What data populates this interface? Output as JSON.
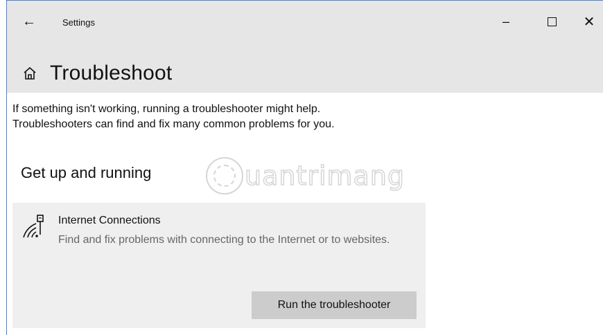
{
  "window": {
    "app_title": "Settings",
    "back_icon": "arrow-left-icon",
    "controls": {
      "minimize": "–",
      "maximize_icon": "square-icon",
      "close": "✕"
    }
  },
  "page": {
    "icon": "home-icon",
    "title": "Troubleshoot",
    "description": [
      "If something isn't working, running a troubleshooter might help.",
      "Troubleshooters can find and fix many common problems for you."
    ]
  },
  "section": {
    "title": "Get up and running"
  },
  "watermark": {
    "text": "uantrimang"
  },
  "troubleshooter": {
    "icon": "network-connection-icon",
    "title": "Internet Connections",
    "description": "Find and fix problems with connecting to the Internet or to websites.",
    "button_label": "Run the troubleshooter"
  },
  "colors": {
    "header_bg": "#e6e6e6",
    "card_bg": "#efefef",
    "button_bg": "#cccccc",
    "window_border": "#5b7fb3"
  }
}
